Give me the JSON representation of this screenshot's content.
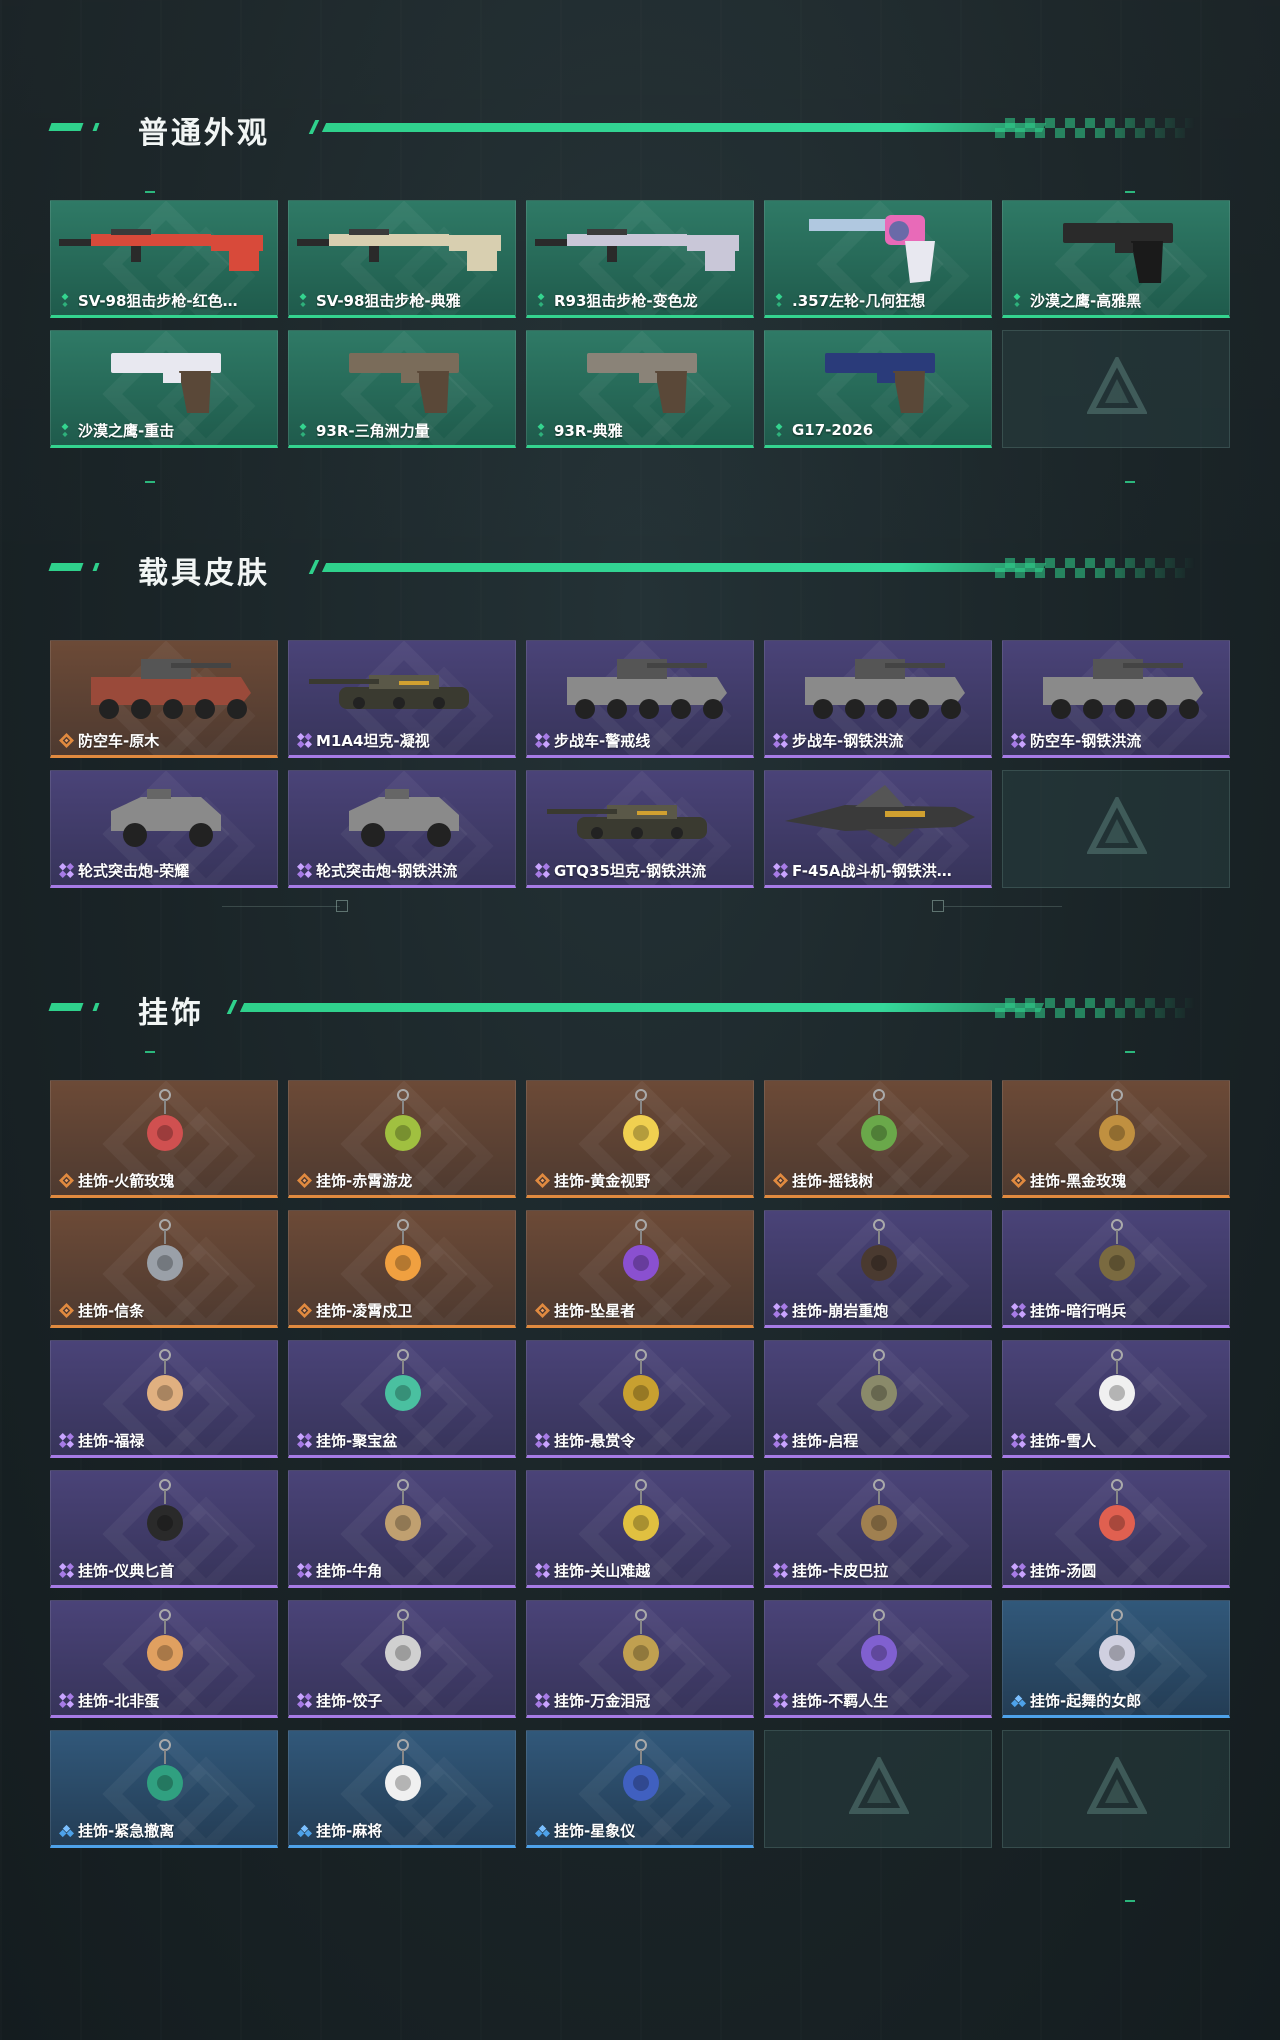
{
  "sections": [
    {
      "title": "普通外观",
      "items": [
        {
          "label": "SV-98狙击步枪-红色…",
          "rarity": "green",
          "icon": "sniper-rifle-red-icon"
        },
        {
          "label": "SV-98狙击步枪-典雅",
          "rarity": "green",
          "icon": "sniper-rifle-elegant-icon"
        },
        {
          "label": "R93狙击步枪-变色龙",
          "rarity": "green",
          "icon": "sniper-rifle-chameleon-icon"
        },
        {
          "label": ".357左轮-几何狂想",
          "rarity": "green",
          "icon": "revolver-icon"
        },
        {
          "label": "沙漠之鹰-高雅黑",
          "rarity": "green",
          "icon": "pistol-black-icon"
        },
        {
          "label": "沙漠之鹰-重击",
          "rarity": "green",
          "icon": "pistol-white-blue-icon"
        },
        {
          "label": "93R-三角洲力量",
          "rarity": "green",
          "icon": "pistol-tan-icon"
        },
        {
          "label": "93R-典雅",
          "rarity": "green",
          "icon": "pistol-grey-icon"
        },
        {
          "label": "G17-2026",
          "rarity": "green",
          "icon": "pistol-navy-icon"
        }
      ]
    },
    {
      "title": "载具皮肤",
      "items": [
        {
          "label": "防空车-原木",
          "rarity": "orange",
          "icon": "armored-vehicle-wood-icon"
        },
        {
          "label": "M1A4坦克-凝视",
          "rarity": "purple",
          "icon": "tank-icon"
        },
        {
          "label": "步战车-警戒线",
          "rarity": "purple",
          "icon": "armored-vehicle-caution-icon"
        },
        {
          "label": "步战车-钢铁洪流",
          "rarity": "purple",
          "icon": "armored-vehicle-steel-icon"
        },
        {
          "label": "防空车-钢铁洪流",
          "rarity": "purple",
          "icon": "armored-vehicle-steel-icon"
        },
        {
          "label": "轮式突击炮-荣耀",
          "rarity": "purple",
          "icon": "buggy-icon"
        },
        {
          "label": "轮式突击炮-钢铁洪流",
          "rarity": "purple",
          "icon": "armored-car-icon"
        },
        {
          "label": "GTQ35坦克-钢铁洪流",
          "rarity": "purple",
          "icon": "tank-steel-icon"
        },
        {
          "label": "F-45A战斗机-钢铁洪…",
          "rarity": "purple",
          "icon": "fighter-jet-icon"
        }
      ]
    },
    {
      "title": "挂饰",
      "items": [
        {
          "label": "挂饰-火箭玫瑰",
          "rarity": "orange",
          "icon": "charm-icon"
        },
        {
          "label": "挂饰-赤霄游龙",
          "rarity": "orange",
          "icon": "charm-icon"
        },
        {
          "label": "挂饰-黄金视野",
          "rarity": "orange",
          "icon": "charm-icon"
        },
        {
          "label": "挂饰-摇钱树",
          "rarity": "orange",
          "icon": "charm-icon"
        },
        {
          "label": "挂饰-黑金玫瑰",
          "rarity": "orange",
          "icon": "charm-icon"
        },
        {
          "label": "挂饰-信条",
          "rarity": "orange",
          "icon": "charm-icon"
        },
        {
          "label": "挂饰-凌霄戍卫",
          "rarity": "orange",
          "icon": "charm-icon"
        },
        {
          "label": "挂饰-坠星者",
          "rarity": "orange",
          "icon": "charm-icon"
        },
        {
          "label": "挂饰-崩岩重炮",
          "rarity": "purple",
          "icon": "charm-icon"
        },
        {
          "label": "挂饰-暗行哨兵",
          "rarity": "purple",
          "icon": "charm-icon"
        },
        {
          "label": "挂饰-福禄",
          "rarity": "purple",
          "icon": "charm-icon"
        },
        {
          "label": "挂饰-聚宝盆",
          "rarity": "purple",
          "icon": "charm-icon"
        },
        {
          "label": "挂饰-悬赏令",
          "rarity": "purple",
          "icon": "charm-icon"
        },
        {
          "label": "挂饰-启程",
          "rarity": "purple",
          "icon": "charm-icon"
        },
        {
          "label": "挂饰-雪人",
          "rarity": "purple",
          "icon": "charm-icon"
        },
        {
          "label": "挂饰-仪典匕首",
          "rarity": "purple",
          "icon": "charm-icon"
        },
        {
          "label": "挂饰-牛角",
          "rarity": "purple",
          "icon": "charm-icon"
        },
        {
          "label": "挂饰-关山难越",
          "rarity": "purple",
          "icon": "charm-icon"
        },
        {
          "label": "挂饰-卡皮巴拉",
          "rarity": "purple",
          "icon": "charm-icon"
        },
        {
          "label": "挂饰-汤圆",
          "rarity": "purple",
          "icon": "charm-icon"
        },
        {
          "label": "挂饰-北非蛋",
          "rarity": "purple",
          "icon": "charm-icon"
        },
        {
          "label": "挂饰-饺子",
          "rarity": "purple",
          "icon": "charm-icon"
        },
        {
          "label": "挂饰-万金泪冠",
          "rarity": "purple",
          "icon": "charm-icon"
        },
        {
          "label": "挂饰-不羁人生",
          "rarity": "purple",
          "icon": "charm-icon"
        },
        {
          "label": "挂饰-起舞的女郎",
          "rarity": "blue",
          "icon": "charm-icon"
        },
        {
          "label": "挂饰-紧急撤离",
          "rarity": "blue",
          "icon": "charm-icon"
        },
        {
          "label": "挂饰-麻将",
          "rarity": "blue",
          "icon": "charm-icon"
        },
        {
          "label": "挂饰-星象仪",
          "rarity": "blue",
          "icon": "charm-icon"
        }
      ]
    }
  ],
  "colors": {
    "accent": "#2fd18c",
    "green": "#34d48f",
    "orange": "#e18a3f",
    "purple": "#a77be6",
    "blue": "#4ea2ea"
  }
}
